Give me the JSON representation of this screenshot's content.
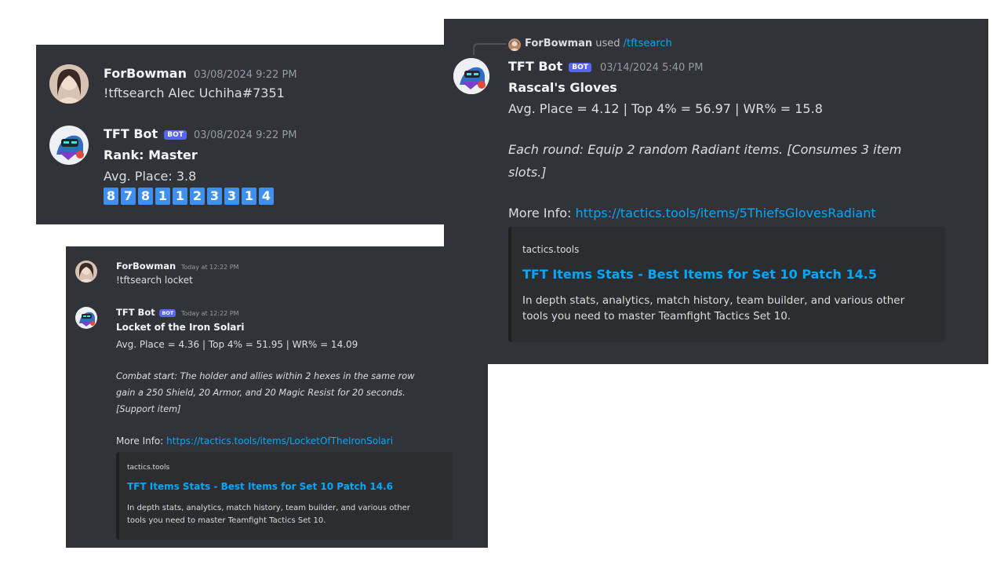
{
  "panel_a": {
    "msg1": {
      "user": "ForBowman",
      "time": "03/08/2024 9:22 PM",
      "text": "!tftsearch Alec Uchiha#7351"
    },
    "msg2": {
      "user": "TFT Bot",
      "badge": "BOT",
      "time": "03/08/2024 9:22 PM",
      "rank": "Rank: Master",
      "avg": "Avg. Place: 3.8",
      "places": [
        "8",
        "7",
        "8",
        "1",
        "1",
        "2",
        "3",
        "3",
        "1",
        "4"
      ]
    }
  },
  "panel_b": {
    "msg1": {
      "user": "ForBowman",
      "time": "Today at 12:22 PM",
      "text": "!tftsearch locket"
    },
    "msg2": {
      "user": "TFT Bot",
      "badge": "BOT",
      "time": "Today at 12:22 PM",
      "item": "Locket of the Iron Solari",
      "stats": "Avg. Place = 4.36 | Top 4% = 51.95 | WR% = 14.09",
      "desc1": "Combat start: The holder and allies within 2 hexes in the same row",
      "desc2": "gain a 250 Shield, 20 Armor, and 20 Magic Resist for 20 seconds.",
      "desc3": "[Support item]",
      "more_label": "More Info:",
      "more_link": "https://tactics.tools/items/LocketOfTheIronSolari",
      "embed": {
        "site": "tactics.tools",
        "title": "TFT Items Stats - Best Items for Set 10 Patch 14.6",
        "body1": "In depth stats, analytics, match history, team builder, and various other",
        "body2": "tools you need to master Teamfight Tactics Set 10."
      }
    }
  },
  "panel_c": {
    "reply": {
      "user": "ForBowman",
      "used": "used",
      "command": "/tftsearch"
    },
    "msg": {
      "user": "TFT Bot",
      "badge": "BOT",
      "time": "03/14/2024 5:40 PM",
      "item": "Rascal's Gloves",
      "stats": "Avg. Place = 4.12 | Top 4% = 56.97 | WR% = 15.8",
      "desc1": "Each round: Equip 2 random Radiant items. [Consumes 3 item",
      "desc2": "slots.]",
      "more_label": "More Info:",
      "more_link": "https://tactics.tools/items/5ThiefsGlovesRadiant",
      "embed": {
        "site": "tactics.tools",
        "title": "TFT Items Stats - Best Items for Set 10 Patch 14.5",
        "body1": "In depth stats, analytics, match history, team builder, and various other",
        "body2": "tools you need to master Teamfight Tactics Set 10."
      }
    }
  },
  "colors": {
    "background": "#313338",
    "embed": "#2b2d31",
    "link": "#00a8fc",
    "bot_badge": "#5865f2",
    "place_badge": "#3d8ff0"
  },
  "icons": {
    "user_avatar": "user-avatar",
    "bot_avatar": "robot-avatar"
  }
}
